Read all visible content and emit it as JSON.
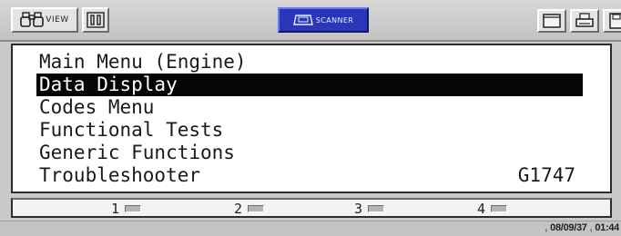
{
  "toolbar": {
    "view_label": "VIEW",
    "view_icon": "binoculars-icon",
    "pause_icon": "pause-icon",
    "scanner_label": "SCANNER",
    "scanner_icon": "scanner-device-icon",
    "right_icons": [
      "window-icon",
      "printer-icon",
      "save-icon"
    ]
  },
  "screen": {
    "title": "Main Menu (Engine)",
    "items": [
      {
        "label": "Data Display",
        "selected": true
      },
      {
        "label": "Codes Menu",
        "selected": false
      },
      {
        "label": "Functional Tests",
        "selected": false
      },
      {
        "label": "Generic Functions",
        "selected": false
      },
      {
        "label": "Troubleshooter",
        "selected": false
      }
    ],
    "code": "G1747"
  },
  "function_keys": [
    {
      "label": "1"
    },
    {
      "label": "2"
    },
    {
      "label": "3"
    },
    {
      "label": "4"
    }
  ],
  "status": {
    "date": "08/09/37",
    "time": "01:44"
  },
  "colors": {
    "highlight": "#050505",
    "scanner_button": "#2a36b8",
    "frame": "#c9c9c9"
  }
}
